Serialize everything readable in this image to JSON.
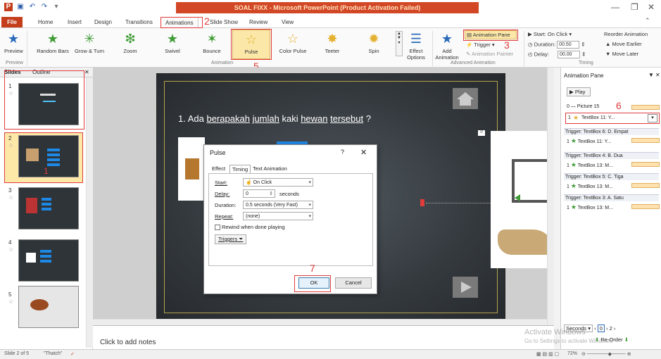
{
  "window": {
    "title": "SOAL FIXX - Microsoft PowerPoint (Product Activation Failed)"
  },
  "tabs": [
    "File",
    "Home",
    "Insert",
    "Design",
    "Transitions",
    "Animations",
    "Slide Show",
    "Review",
    "View"
  ],
  "ribbon": {
    "preview": "Preview",
    "preview_group": "Preview",
    "effects": [
      "Random Bars",
      "Grow & Turn",
      "Zoom",
      "Swivel",
      "Bounce",
      "Pulse",
      "Color Pulse",
      "Teeter",
      "Spin"
    ],
    "effect_options": "Effect Options",
    "animation_group": "Animation",
    "add_animation": "Add Animation",
    "animation_pane": "Animation Pane",
    "trigger": "Trigger",
    "animation_painter": "Animation Painter",
    "advanced_group": "Advanced Animation",
    "start_label": "Start:",
    "start_value": "On Click",
    "duration_label": "Duration:",
    "duration_value": "00.50",
    "delay_label": "Delay:",
    "delay_value": "00.00",
    "reorder": "Reorder Animation",
    "move_earlier": "Move Earlier",
    "move_later": "Move Later",
    "timing_group": "Timing"
  },
  "annotations": [
    "2",
    "3",
    "5",
    "6",
    "7",
    "1"
  ],
  "left_panel": {
    "tab_slides": "Slides",
    "tab_outline": "Outline",
    "slide_numbers": [
      "1",
      "2",
      "3",
      "4",
      "5"
    ]
  },
  "slide": {
    "question_prefix": "1. Ada ",
    "question_link1": "berapakah",
    "question_mid": " ",
    "question_link2": "jumlah",
    "question_mid2": " kaki ",
    "question_link3": "hewan",
    "question_mid3": " ",
    "question_link4": "tersebut",
    "question_suffix": " ?",
    "badge": "0"
  },
  "dialog": {
    "title": "Pulse",
    "help": "?",
    "close": "✕",
    "tabs": [
      "Effect",
      "Timing",
      "Text Animation"
    ],
    "start_label": "Start:",
    "start_value": "On Click",
    "delay_label": "Delay:",
    "delay_value": "0",
    "delay_unit": "seconds",
    "duration_label": "Duration:",
    "duration_value": "0.5 seconds (Very Fast)",
    "repeat_label": "Repeat:",
    "repeat_value": "(none)",
    "rewind": "Rewind when done playing",
    "triggers": "Triggers",
    "ok": "OK",
    "cancel": "Cancel"
  },
  "anim_pane": {
    "title": "Animation Pane",
    "play": "Play",
    "items": [
      {
        "num": "0",
        "label": "Picture 15"
      },
      {
        "num": "1",
        "label": "TextBox 11: Y..."
      }
    ],
    "triggers": [
      {
        "label": "Trigger: TextBox 6: D. Empat",
        "item": "TextBox 11: Y..."
      },
      {
        "label": "Trigger: TextBox 4: B. Dua",
        "item": "TextBox 13: M..."
      },
      {
        "label": "Trigger: TextBox 5: C. Tiga",
        "item": "TextBox 13: M..."
      },
      {
        "label": "Trigger: TextBox 3: A. Satu",
        "item": "TextBox 13: M..."
      }
    ],
    "seconds": "Seconds",
    "page_a": "0",
    "page_b": "2",
    "reorder": "Re-Order"
  },
  "notes": {
    "placeholder": "Click to add notes"
  },
  "status": {
    "slide": "Slide 2 of 5",
    "theme": "\"Thatch\"",
    "zoom": "72%"
  },
  "watermark": {
    "line1": "Activate Windows",
    "line2": "Go to Settings to activate Windows."
  },
  "colors": {
    "ppt_orange": "#c43e1c",
    "title_red": "#d24726",
    "annotation_red": "#e03c3c",
    "slide_dark": "#34393e",
    "anim_green": "#3f9c35"
  }
}
